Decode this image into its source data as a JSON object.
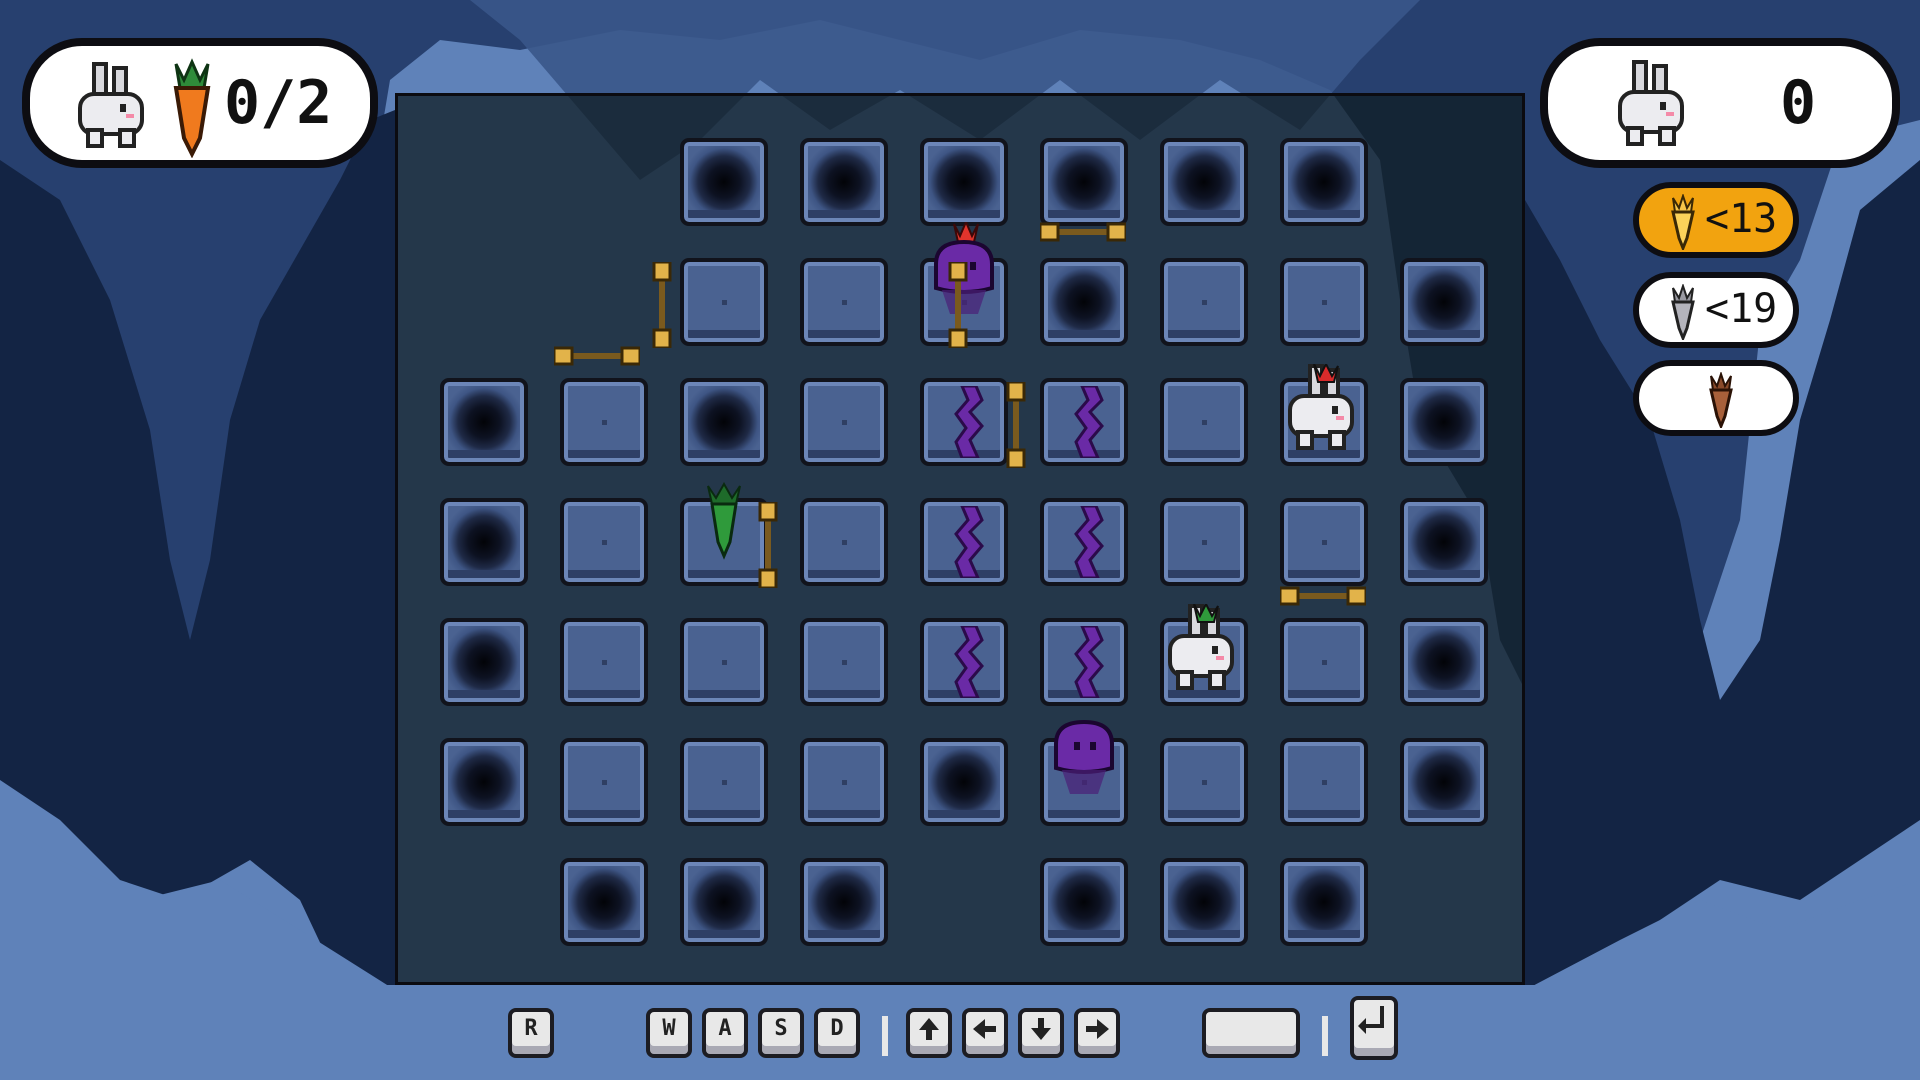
{
  "hud": {
    "carrots_collected": "0/2",
    "move_counter": "0"
  },
  "medals": [
    {
      "name": "gold-carrot",
      "label": "<13",
      "color": "#f2a30f"
    },
    {
      "name": "silver-carrot",
      "label": "<19",
      "color": "#ffffff"
    },
    {
      "name": "bronze-carrot",
      "label": "",
      "color": "#ffffff"
    }
  ],
  "controls": {
    "restart_key": "R",
    "move_keys": [
      "W",
      "A",
      "S",
      "D"
    ],
    "arrow_keys": [
      "up-arrow-icon",
      "left-arrow-icon",
      "down-arrow-icon",
      "right-arrow-icon"
    ],
    "space_key": "space-bar-icon",
    "enter_key": "enter-key-icon"
  },
  "colors": {
    "background": "#5f82b9",
    "cave_dark": "#16284a",
    "tile": "#4a6291",
    "goo": "#6a2aa6",
    "carrot_orange": "#f07a1e",
    "gold": "#f2a30f"
  },
  "board": {
    "rows": [
      [
        "empty",
        "empty",
        "pit",
        "pit",
        "pit",
        "pit",
        "pit",
        "pit",
        "empty"
      ],
      [
        "empty",
        "empty",
        "floor",
        "floor",
        "floor-blob",
        "pit",
        "floor",
        "floor",
        "pit"
      ],
      [
        "pit",
        "floor",
        "pit",
        "floor",
        "goo",
        "goo",
        "floor",
        "floor-bunny",
        "pit"
      ],
      [
        "pit",
        "floor",
        "floor-carrot",
        "floor",
        "goo",
        "goo",
        "floor",
        "floor",
        "pit"
      ],
      [
        "pit",
        "floor",
        "floor",
        "floor",
        "goo",
        "goo",
        "floor-bunny2",
        "floor",
        "pit"
      ],
      [
        "pit",
        "floor",
        "floor",
        "floor",
        "pit",
        "floor-blob",
        "floor",
        "floor",
        "pit"
      ],
      [
        "empty",
        "pit",
        "pit",
        "pit",
        "empty",
        "pit",
        "pit",
        "pit",
        "empty"
      ]
    ]
  }
}
